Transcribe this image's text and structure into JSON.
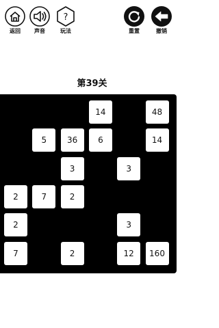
{
  "toolbar": {
    "back_label": "返回",
    "sound_label": "声音",
    "help_label": "玩法",
    "help_glyph": "?",
    "reset_label": "重置",
    "undo_label": "撤销"
  },
  "level": {
    "title": "第39关"
  },
  "board": {
    "rows": 6,
    "cols": 6,
    "tiles": [
      {
        "row": 0,
        "col": 3,
        "value": "14"
      },
      {
        "row": 0,
        "col": 5,
        "value": "48"
      },
      {
        "row": 1,
        "col": 1,
        "value": "5"
      },
      {
        "row": 1,
        "col": 2,
        "value": "36"
      },
      {
        "row": 1,
        "col": 3,
        "value": "6"
      },
      {
        "row": 1,
        "col": 5,
        "value": "14"
      },
      {
        "row": 2,
        "col": 2,
        "value": "3"
      },
      {
        "row": 2,
        "col": 4,
        "value": "3"
      },
      {
        "row": 3,
        "col": 0,
        "value": "2"
      },
      {
        "row": 3,
        "col": 1,
        "value": "7"
      },
      {
        "row": 3,
        "col": 2,
        "value": "2"
      },
      {
        "row": 4,
        "col": 0,
        "value": "2"
      },
      {
        "row": 4,
        "col": 4,
        "value": "3"
      },
      {
        "row": 5,
        "col": 0,
        "value": "7"
      },
      {
        "row": 5,
        "col": 2,
        "value": "2"
      },
      {
        "row": 5,
        "col": 4,
        "value": "12"
      },
      {
        "row": 5,
        "col": 5,
        "value": "160"
      }
    ]
  }
}
